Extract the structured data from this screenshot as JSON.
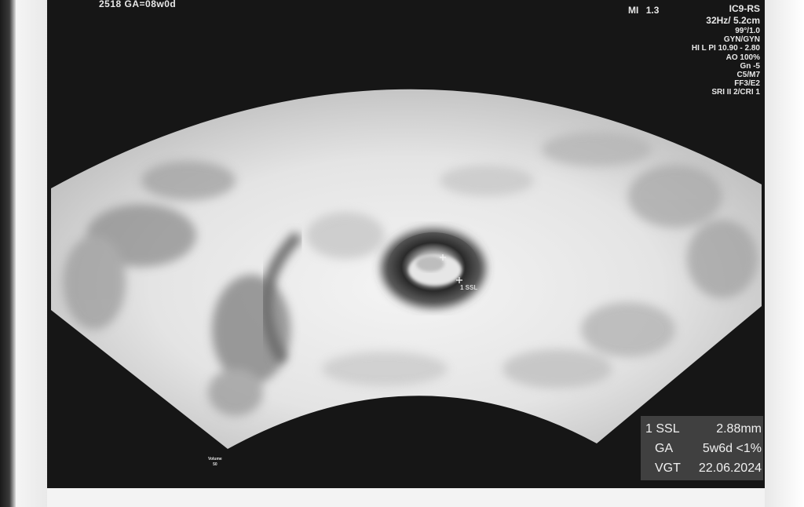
{
  "header": {
    "left_text": "2518  GA=08w0d",
    "mi_label": "MI",
    "mi_value": "1.3"
  },
  "parameters": [
    "IC9-RS",
    "32Hz/ 5.2cm",
    "99°/1.0",
    "GYN/GYN",
    "HI L PI 10.90 - 2.80",
    "AO 100%",
    "Gn -5",
    "C5/M7",
    "FF3/E2",
    "SRI II 2/CRI 1"
  ],
  "measurements": {
    "ssl_label": "1 SSL",
    "ssl_value": "2.88mm",
    "ga_label": "GA",
    "ga_value": "5w6d <1%",
    "vgt_label": "VGT",
    "vgt_value": "22.06.2024"
  },
  "volume": {
    "label": "Volume",
    "value": "50"
  },
  "calliper_tag": "1 SSL"
}
